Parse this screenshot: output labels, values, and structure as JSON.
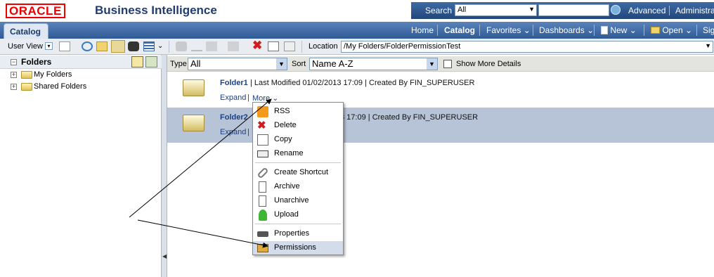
{
  "header": {
    "logo": "ORACLE",
    "app_title": "Business Intelligence",
    "search_label": "Search",
    "search_scope": "All",
    "advanced_label": "Advanced",
    "admin_label": "Administrati"
  },
  "nav": {
    "active_tab": "Catalog",
    "items": [
      "Home",
      "Catalog",
      "Favorites",
      "Dashboards",
      "New",
      "Open",
      "Sig"
    ]
  },
  "toolbar": {
    "user_view_label": "User View",
    "location_label": "Location",
    "location_value": "/My Folders/FolderPermissionTest"
  },
  "sidebar": {
    "title": "Folders",
    "items": [
      "My Folders",
      "Shared Folders"
    ]
  },
  "filter": {
    "type_label": "Type",
    "type_value": "All",
    "sort_label": "Sort",
    "sort_value": "Name A-Z",
    "show_more_label": "Show More Details"
  },
  "rows": [
    {
      "name": "Folder1",
      "modified": "Last Modified 01/02/2013 17:09",
      "created": "Created By FIN_SUPERUSER",
      "expand": "Expand",
      "more": "More"
    },
    {
      "name": "Folder2",
      "modified": "3 17:09",
      "created": "Created By FIN_SUPERUSER",
      "expand": "Expand"
    }
  ],
  "menu": {
    "items": [
      "RSS",
      "Delete",
      "Copy",
      "Rename",
      "Create Shortcut",
      "Archive",
      "Unarchive",
      "Upload",
      "Properties",
      "Permissions"
    ],
    "highlighted": "Permissions"
  }
}
